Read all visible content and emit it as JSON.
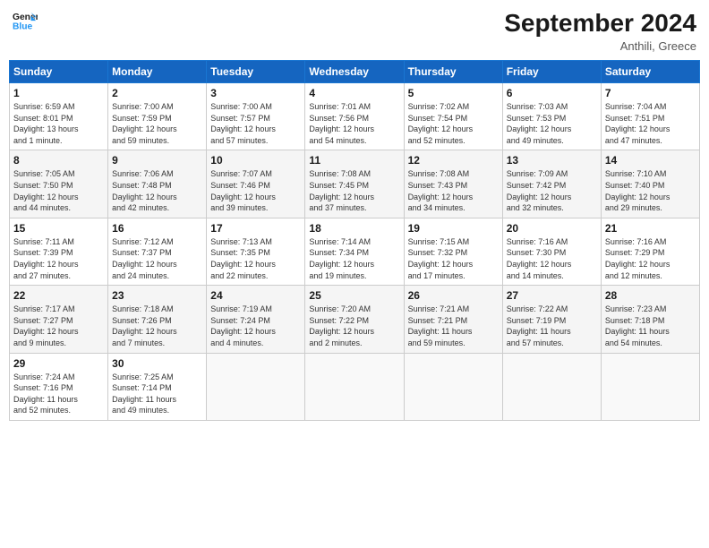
{
  "logo": {
    "line1": "General",
    "line2": "Blue"
  },
  "title": "September 2024",
  "location": "Anthili, Greece",
  "days_of_week": [
    "Sunday",
    "Monday",
    "Tuesday",
    "Wednesday",
    "Thursday",
    "Friday",
    "Saturday"
  ],
  "weeks": [
    [
      {
        "day": "1",
        "info": "Sunrise: 6:59 AM\nSunset: 8:01 PM\nDaylight: 13 hours\nand 1 minute."
      },
      {
        "day": "2",
        "info": "Sunrise: 7:00 AM\nSunset: 7:59 PM\nDaylight: 12 hours\nand 59 minutes."
      },
      {
        "day": "3",
        "info": "Sunrise: 7:00 AM\nSunset: 7:57 PM\nDaylight: 12 hours\nand 57 minutes."
      },
      {
        "day": "4",
        "info": "Sunrise: 7:01 AM\nSunset: 7:56 PM\nDaylight: 12 hours\nand 54 minutes."
      },
      {
        "day": "5",
        "info": "Sunrise: 7:02 AM\nSunset: 7:54 PM\nDaylight: 12 hours\nand 52 minutes."
      },
      {
        "day": "6",
        "info": "Sunrise: 7:03 AM\nSunset: 7:53 PM\nDaylight: 12 hours\nand 49 minutes."
      },
      {
        "day": "7",
        "info": "Sunrise: 7:04 AM\nSunset: 7:51 PM\nDaylight: 12 hours\nand 47 minutes."
      }
    ],
    [
      {
        "day": "8",
        "info": "Sunrise: 7:05 AM\nSunset: 7:50 PM\nDaylight: 12 hours\nand 44 minutes."
      },
      {
        "day": "9",
        "info": "Sunrise: 7:06 AM\nSunset: 7:48 PM\nDaylight: 12 hours\nand 42 minutes."
      },
      {
        "day": "10",
        "info": "Sunrise: 7:07 AM\nSunset: 7:46 PM\nDaylight: 12 hours\nand 39 minutes."
      },
      {
        "day": "11",
        "info": "Sunrise: 7:08 AM\nSunset: 7:45 PM\nDaylight: 12 hours\nand 37 minutes."
      },
      {
        "day": "12",
        "info": "Sunrise: 7:08 AM\nSunset: 7:43 PM\nDaylight: 12 hours\nand 34 minutes."
      },
      {
        "day": "13",
        "info": "Sunrise: 7:09 AM\nSunset: 7:42 PM\nDaylight: 12 hours\nand 32 minutes."
      },
      {
        "day": "14",
        "info": "Sunrise: 7:10 AM\nSunset: 7:40 PM\nDaylight: 12 hours\nand 29 minutes."
      }
    ],
    [
      {
        "day": "15",
        "info": "Sunrise: 7:11 AM\nSunset: 7:39 PM\nDaylight: 12 hours\nand 27 minutes."
      },
      {
        "day": "16",
        "info": "Sunrise: 7:12 AM\nSunset: 7:37 PM\nDaylight: 12 hours\nand 24 minutes."
      },
      {
        "day": "17",
        "info": "Sunrise: 7:13 AM\nSunset: 7:35 PM\nDaylight: 12 hours\nand 22 minutes."
      },
      {
        "day": "18",
        "info": "Sunrise: 7:14 AM\nSunset: 7:34 PM\nDaylight: 12 hours\nand 19 minutes."
      },
      {
        "day": "19",
        "info": "Sunrise: 7:15 AM\nSunset: 7:32 PM\nDaylight: 12 hours\nand 17 minutes."
      },
      {
        "day": "20",
        "info": "Sunrise: 7:16 AM\nSunset: 7:30 PM\nDaylight: 12 hours\nand 14 minutes."
      },
      {
        "day": "21",
        "info": "Sunrise: 7:16 AM\nSunset: 7:29 PM\nDaylight: 12 hours\nand 12 minutes."
      }
    ],
    [
      {
        "day": "22",
        "info": "Sunrise: 7:17 AM\nSunset: 7:27 PM\nDaylight: 12 hours\nand 9 minutes."
      },
      {
        "day": "23",
        "info": "Sunrise: 7:18 AM\nSunset: 7:26 PM\nDaylight: 12 hours\nand 7 minutes."
      },
      {
        "day": "24",
        "info": "Sunrise: 7:19 AM\nSunset: 7:24 PM\nDaylight: 12 hours\nand 4 minutes."
      },
      {
        "day": "25",
        "info": "Sunrise: 7:20 AM\nSunset: 7:22 PM\nDaylight: 12 hours\nand 2 minutes."
      },
      {
        "day": "26",
        "info": "Sunrise: 7:21 AM\nSunset: 7:21 PM\nDaylight: 11 hours\nand 59 minutes."
      },
      {
        "day": "27",
        "info": "Sunrise: 7:22 AM\nSunset: 7:19 PM\nDaylight: 11 hours\nand 57 minutes."
      },
      {
        "day": "28",
        "info": "Sunrise: 7:23 AM\nSunset: 7:18 PM\nDaylight: 11 hours\nand 54 minutes."
      }
    ],
    [
      {
        "day": "29",
        "info": "Sunrise: 7:24 AM\nSunset: 7:16 PM\nDaylight: 11 hours\nand 52 minutes."
      },
      {
        "day": "30",
        "info": "Sunrise: 7:25 AM\nSunset: 7:14 PM\nDaylight: 11 hours\nand 49 minutes."
      },
      {
        "day": "",
        "info": ""
      },
      {
        "day": "",
        "info": ""
      },
      {
        "day": "",
        "info": ""
      },
      {
        "day": "",
        "info": ""
      },
      {
        "day": "",
        "info": ""
      }
    ]
  ]
}
